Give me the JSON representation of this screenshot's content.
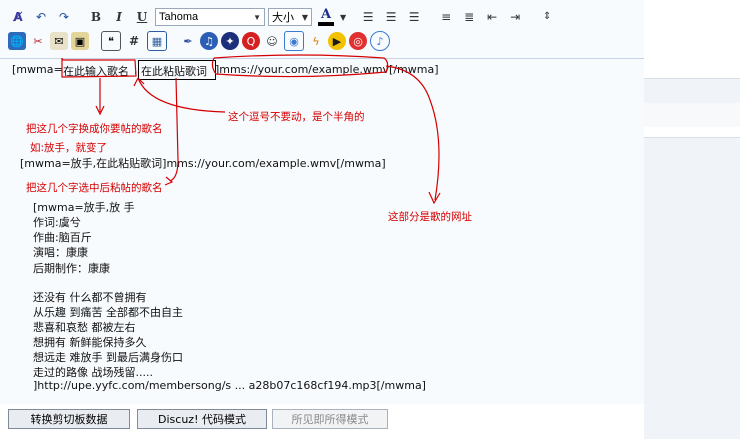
{
  "toolbar": {
    "font_name": "Tahoma",
    "font_size": "大小",
    "color_letter": "A",
    "bold": "B",
    "italic": "I",
    "underline": "U",
    "hash": "#"
  },
  "editor": {
    "line1_prefix": "[mwma=",
    "line1_box1": "在此输入歌名",
    "line1_comma": ",",
    "line1_box2": "在此粘贴歌词",
    "line1_suffix": "]mms://your.com/example.wmv[/mwma]",
    "example_line": "[mwma=放手,在此粘贴歌词]mms://your.com/example.wmv[/mwma]",
    "lyrics_header": [
      "[mwma=放手,放 手",
      "作词:虞兮",
      "作曲:脑百斤",
      "演唱：康康",
      "后期制作：康康"
    ],
    "lyrics_body": [
      "还没有 什么都不曾拥有",
      "从乐趣 到痛苦 全部都不由自主",
      "悲喜和哀愁 都被左右",
      "想拥有 新鲜能保持多久",
      "想远走 难放手 到最后满身伤口",
      "走过的路像 战场残留.....",
      "]http://upe.yyfc.com/membersong/s ... a28b07c168cf194.mp3[/mwma]"
    ]
  },
  "annotations": {
    "replace_name": "把这几个字换成你要帖的歌名",
    "comma_note": "这个逗号不要动，是个半角的",
    "example": "如:放手，就变了",
    "select_paste": "把这几个字选中后粘帖的歌名",
    "url_note": "这部分是歌的网址"
  },
  "bottom": {
    "clipboard_button": "转换剪切板数据",
    "discuz_button": "Discuz! 代码模式",
    "wysiwyg_button": "所见即所得模式"
  },
  "colors": {
    "annotation_red": "#d40000",
    "editor_bg": "#f8fbfe"
  }
}
